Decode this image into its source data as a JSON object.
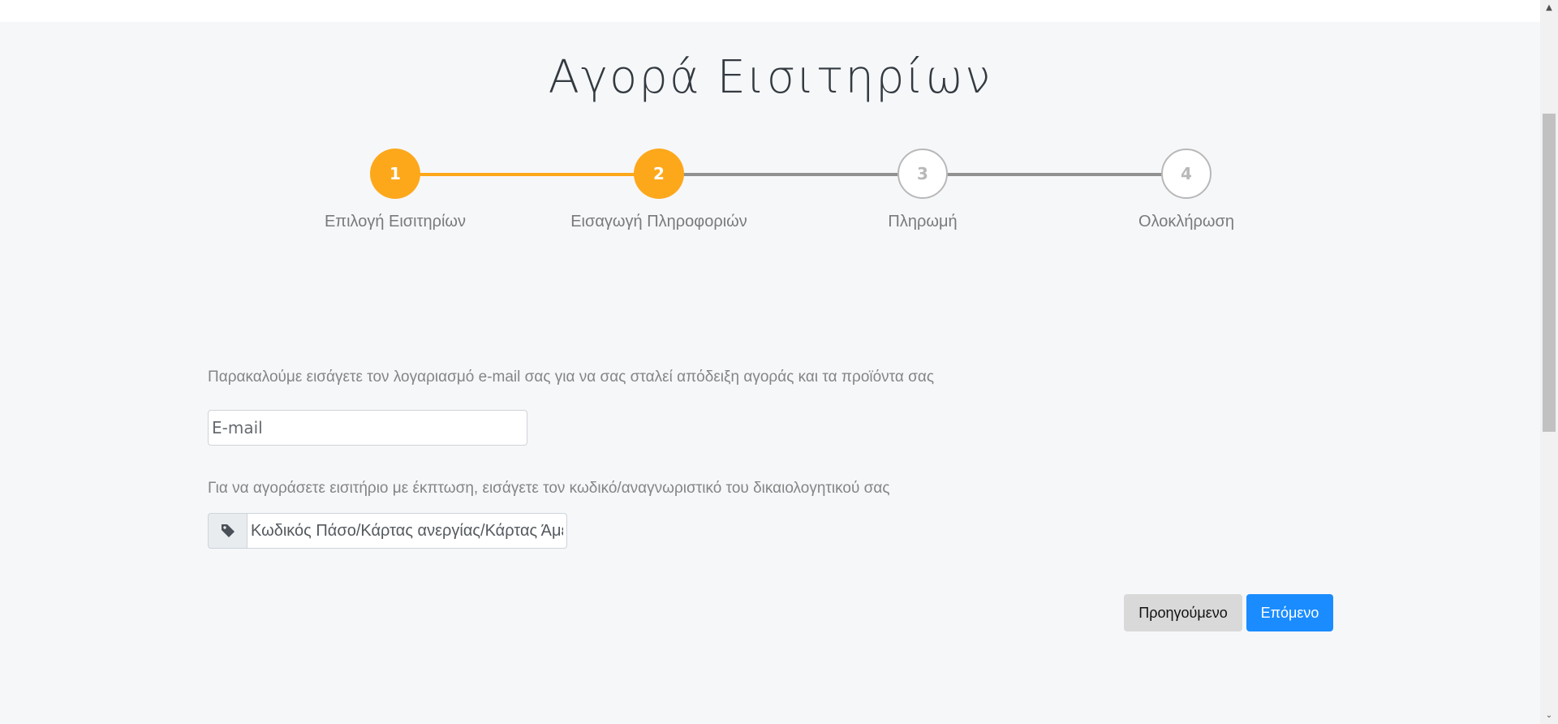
{
  "page": {
    "title": "Αγορά Εισιτηρίων"
  },
  "stepper": {
    "steps": [
      {
        "number": "1",
        "label": "Επιλογή Εισιτηρίων",
        "state": "completed"
      },
      {
        "number": "2",
        "label": "Εισαγωγή Πληροφοριών",
        "state": "current"
      },
      {
        "number": "3",
        "label": "Πληρωμή",
        "state": "pending"
      },
      {
        "number": "4",
        "label": "Ολοκλήρωση",
        "state": "pending"
      }
    ],
    "colors": {
      "active": "#fda81b",
      "inactive_line": "#919191",
      "inactive_circle_border": "#b8b8b8"
    }
  },
  "form": {
    "email_prompt": "Παρακαλούμε εισάγετε τον λογαριασμό e-mail σας για να σας σταλεί απόδειξη αγοράς και τα προϊόντα σας",
    "email_placeholder": "E-mail",
    "email_value": "",
    "discount_prompt": "Για να αγοράσετε εισιτήριο με έκπτωση, εισάγετε τον κωδικό/αναγνωριστικό του δικαιολογητικού σας",
    "discount_placeholder": "Κωδικός Πάσο/Κάρτας ανεργίας/Κάρτας Άμεσης Δράσης",
    "discount_value": "",
    "discount_icon": "tag-icon"
  },
  "actions": {
    "previous_label": "Προηγούμενο",
    "next_label": "Επόμενο",
    "next_color": "#1a8cff"
  }
}
